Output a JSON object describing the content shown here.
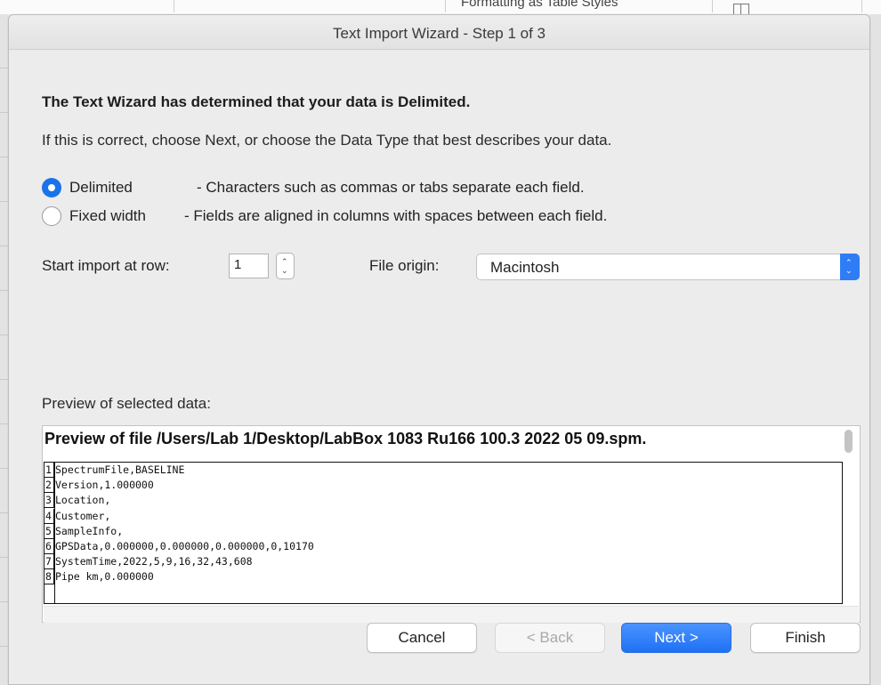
{
  "ribbon": {
    "fragment_text": "Formatting   as Table     Styles"
  },
  "dialog": {
    "title": "Text Import Wizard - Step 1 of 3",
    "heading": "The Text Wizard has determined that your data is Delimited.",
    "subtext": "If this is correct, choose Next, or choose the Data Type that best describes your data.",
    "data_types": [
      {
        "label": "Delimited",
        "description": "- Characters such as commas or tabs separate each field.",
        "selected": true
      },
      {
        "label": "Fixed width",
        "description": "- Fields are aligned in columns with spaces between each field.",
        "selected": false
      }
    ],
    "start_row": {
      "label": "Start import at row:",
      "value": "1"
    },
    "file_origin": {
      "label": "File origin:",
      "value": "Macintosh"
    },
    "preview": {
      "label": "Preview of selected data:",
      "title": "Preview of file /Users/Lab 1/Desktop/LabBox 1083 Ru166 100.3 2022 05 09.spm.",
      "rows": [
        {
          "num": "1",
          "text": "SpectrumFile,BASELINE"
        },
        {
          "num": "2",
          "text": "Version,1.000000"
        },
        {
          "num": "3",
          "text": "Location,"
        },
        {
          "num": "4",
          "text": "Customer,"
        },
        {
          "num": "5",
          "text": "SampleInfo,"
        },
        {
          "num": "6",
          "text": "GPSData,0.000000,0.000000,0.000000,0,10170"
        },
        {
          "num": "7",
          "text": "SystemTime,2022,5,9,16,32,43,608"
        },
        {
          "num": "8",
          "text": "Pipe km,0.000000"
        }
      ]
    },
    "buttons": {
      "cancel": "Cancel",
      "back": "< Back",
      "next": "Next >",
      "finish": "Finish"
    }
  },
  "colors": {
    "accent": "#1a73e8",
    "primary_button": "#2f7df6",
    "dialog_bg": "#ececec"
  }
}
